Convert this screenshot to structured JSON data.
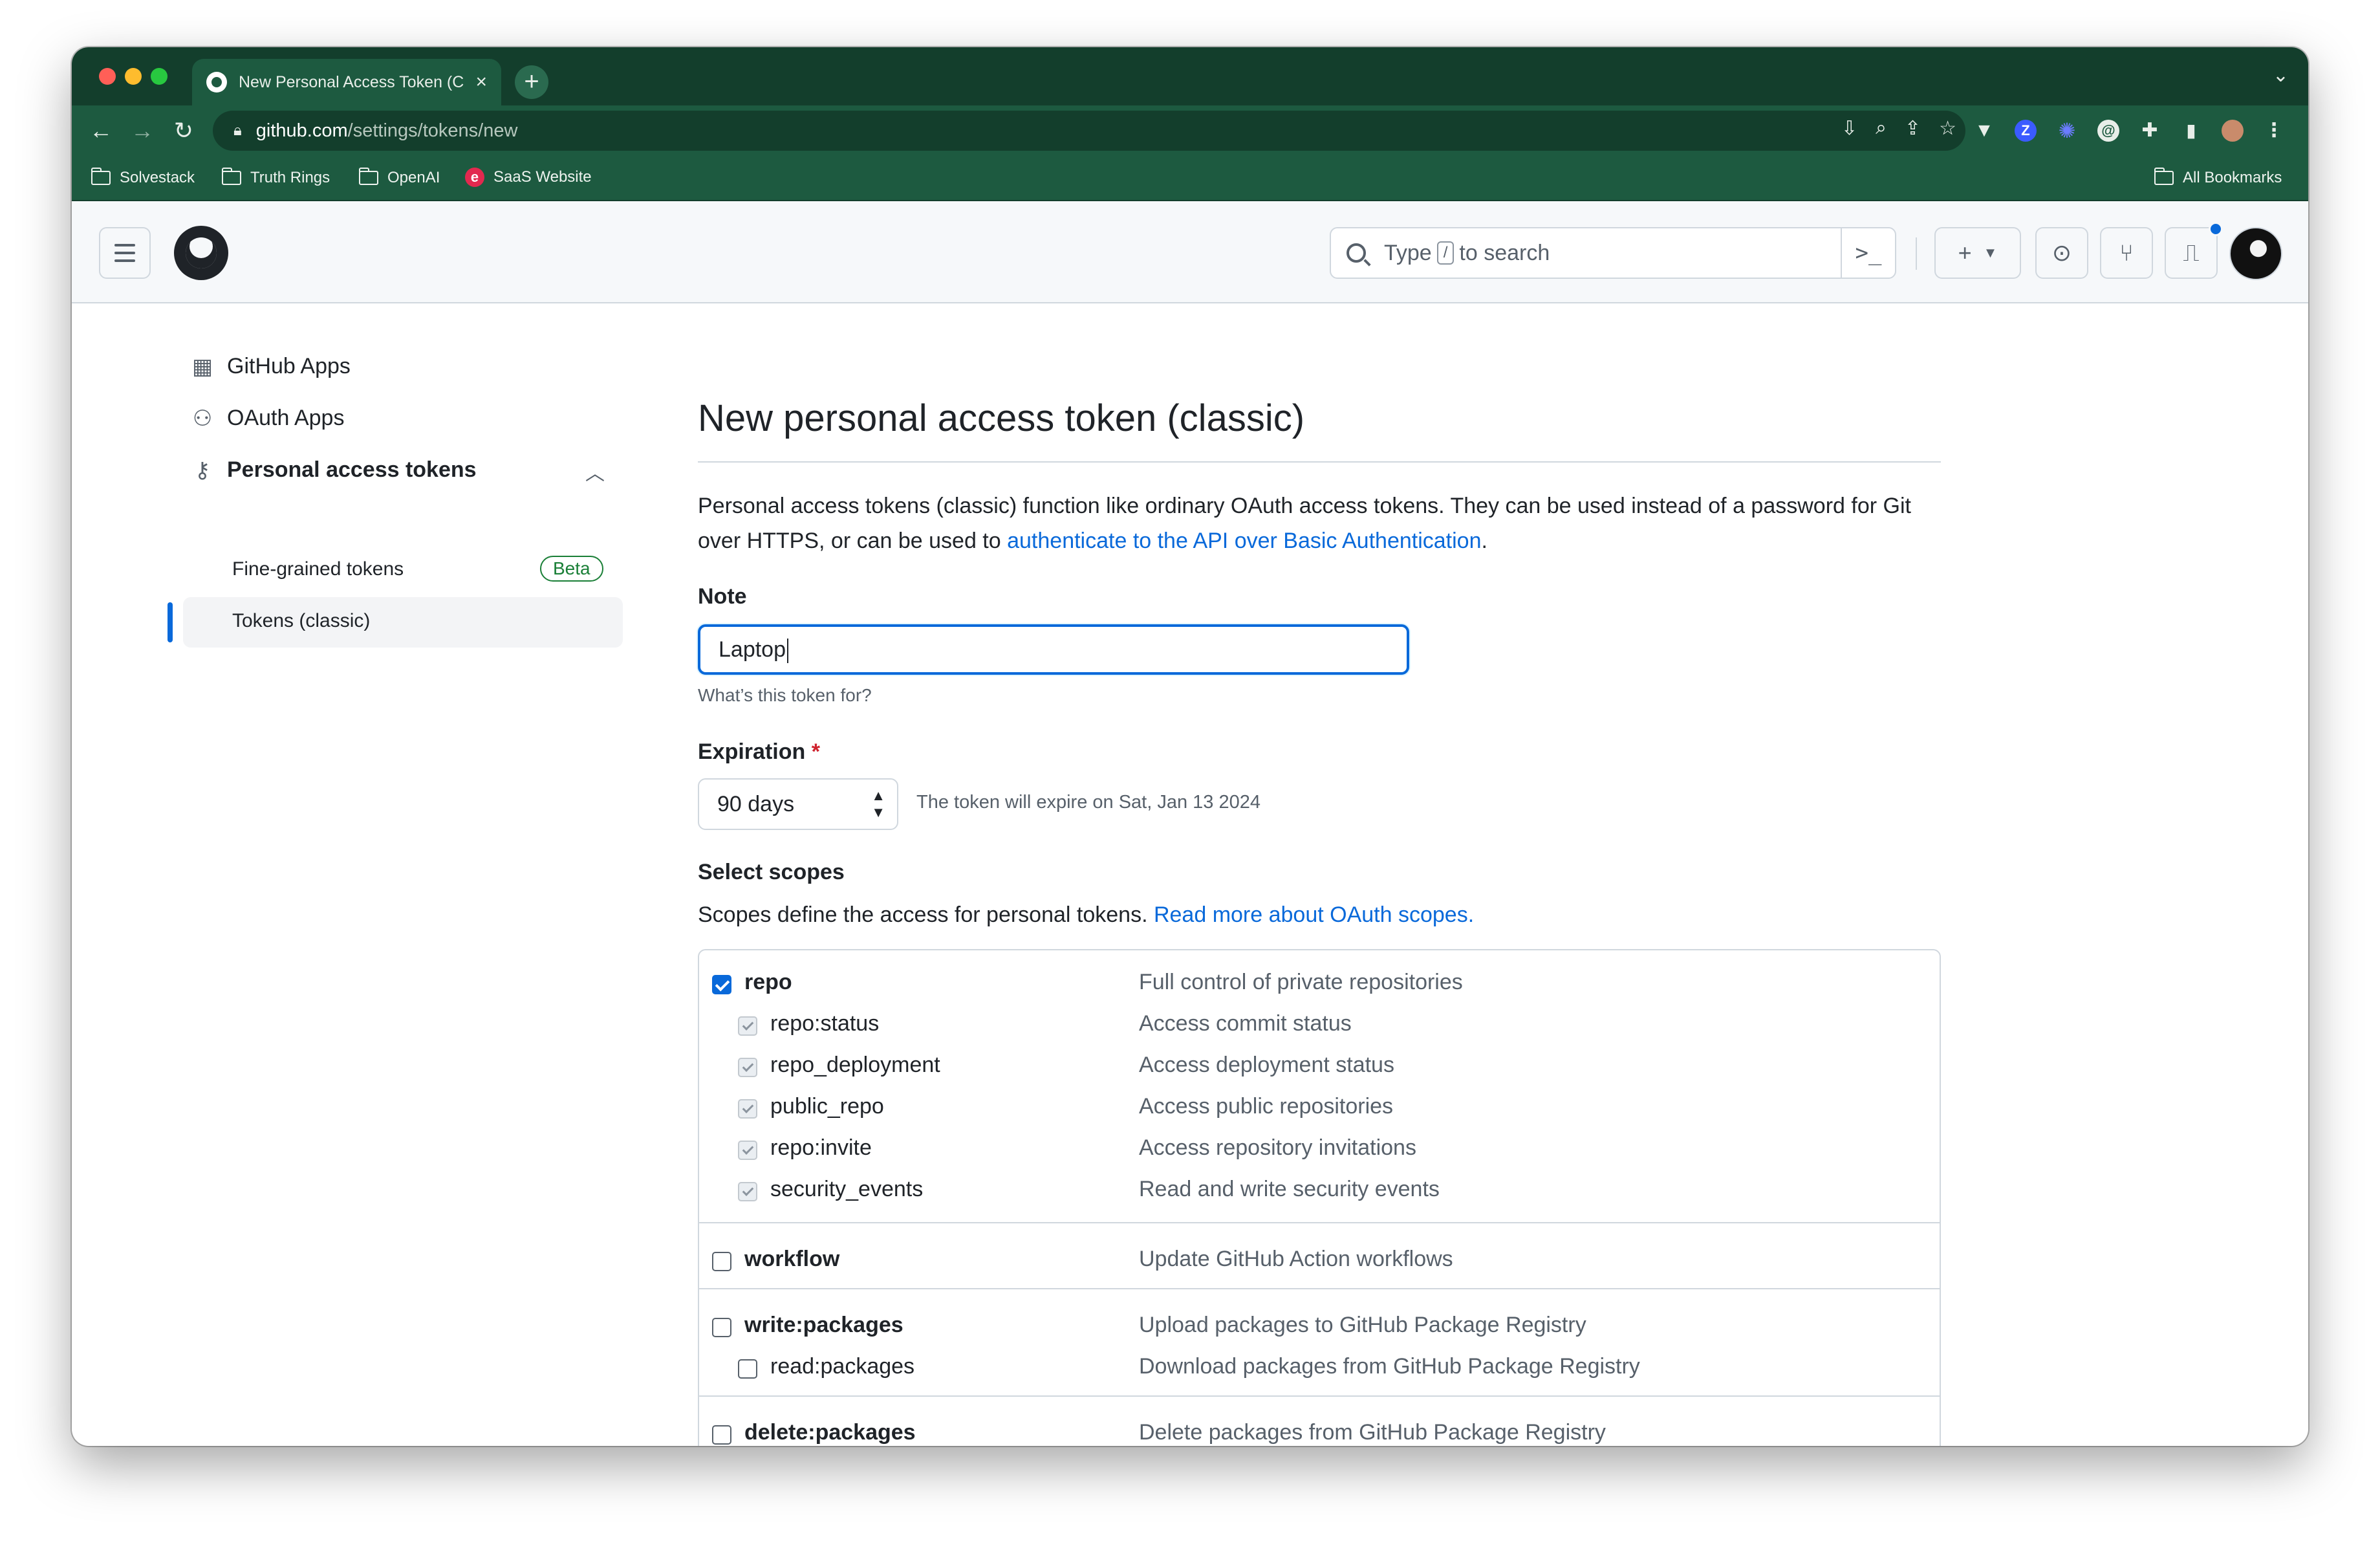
{
  "browser": {
    "tab_title": "New Personal Access Token (C",
    "url_host": "github.com",
    "url_path": "/settings/tokens/new",
    "bookmarks": [
      "Solvestack",
      "Truth Rings",
      "OpenAI",
      "SaaS Website"
    ],
    "all_bookmarks": "All Bookmarks"
  },
  "header": {
    "search_prefix": "Type",
    "search_key": "/",
    "search_suffix": "to search",
    "command_icon": ">_"
  },
  "sidebar": {
    "items": [
      {
        "label": "GitHub Apps",
        "icon": "apps-grid-icon"
      },
      {
        "label": "OAuth Apps",
        "icon": "person-icon"
      },
      {
        "label": "Personal access tokens",
        "icon": "key-icon"
      }
    ],
    "sub_items": [
      {
        "label": "Fine-grained tokens",
        "badge": "Beta"
      },
      {
        "label": "Tokens (classic)"
      }
    ]
  },
  "main": {
    "title": "New personal access token (classic)",
    "description_1": "Personal access tokens (classic) function like ordinary OAuth access tokens. They can be used instead of a password for Git over HTTPS, or can be used to ",
    "description_link": "authenticate to the API over Basic Authentication",
    "description_2": ".",
    "note_label": "Note",
    "note_value": "Laptop",
    "note_hint": "What’s this token for?",
    "expiration_label": "Expiration",
    "expiration_required": "*",
    "expiration_value": "90 days",
    "expiration_note": "The token will expire on Sat, Jan 13 2024",
    "scopes_label": "Select scopes",
    "scopes_desc": "Scopes define the access for personal tokens. ",
    "scopes_link": "Read more about OAuth scopes."
  },
  "scopes": [
    {
      "name": "repo",
      "desc": "Full control of private repositories",
      "checked": true,
      "parent": true
    },
    {
      "name": "repo:status",
      "desc": "Access commit status",
      "checked": true,
      "parent": false
    },
    {
      "name": "repo_deployment",
      "desc": "Access deployment status",
      "checked": true,
      "parent": false
    },
    {
      "name": "public_repo",
      "desc": "Access public repositories",
      "checked": true,
      "parent": false
    },
    {
      "name": "repo:invite",
      "desc": "Access repository invitations",
      "checked": true,
      "parent": false
    },
    {
      "name": "security_events",
      "desc": "Read and write security events",
      "checked": true,
      "parent": false
    },
    {
      "name": "workflow",
      "desc": "Update GitHub Action workflows",
      "checked": false,
      "parent": true
    },
    {
      "name": "write:packages",
      "desc": "Upload packages to GitHub Package Registry",
      "checked": false,
      "parent": true
    },
    {
      "name": "read:packages",
      "desc": "Download packages from GitHub Package Registry",
      "checked": false,
      "parent": false
    },
    {
      "name": "delete:packages",
      "desc": "Delete packages from GitHub Package Registry",
      "checked": false,
      "parent": true
    }
  ],
  "colors": {
    "accent": "#0969da",
    "browser_chrome": "#1d5a40",
    "beta": "#1a7f37"
  }
}
